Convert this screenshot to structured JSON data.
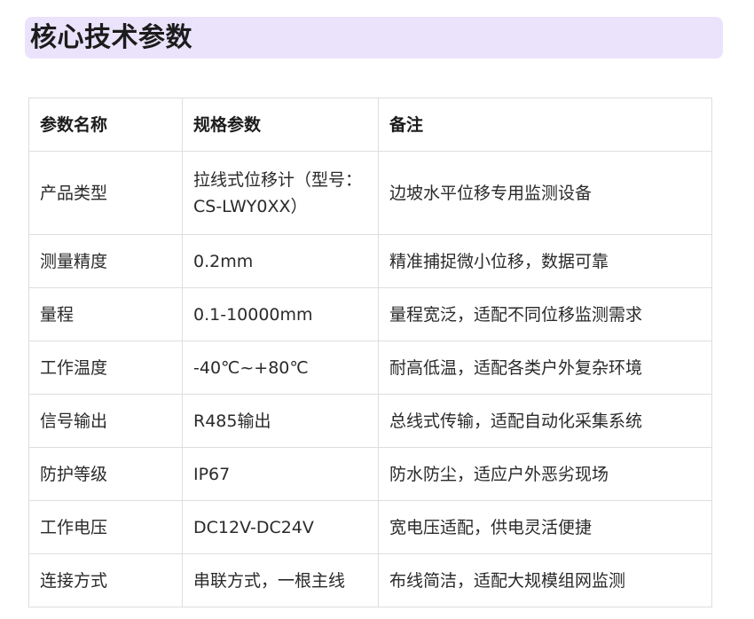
{
  "heading": "核心技术参数",
  "table": {
    "headers": [
      "参数名称",
      "规格参数",
      "备注"
    ],
    "rows": [
      [
        "产品类型",
        "拉线式位移计（型号：CS-LWY0XX）",
        "边坡水平位移专用监测设备"
      ],
      [
        "测量精度",
        "0.2mm",
        "精准捕捉微小位移，数据可靠"
      ],
      [
        "量程",
        "0.1-10000mm",
        "量程宽泛，适配不同位移监测需求"
      ],
      [
        "工作温度",
        "-40℃~+80℃",
        "耐高低温，适配各类户外复杂环境"
      ],
      [
        "信号输出",
        "R485输出",
        "总线式传输，适配自动化采集系统"
      ],
      [
        "防护等级",
        "IP67",
        "防水防尘，适应户外恶劣现场"
      ],
      [
        "工作电压",
        "DC12V-DC24V",
        "宽电压适配，供电灵活便捷"
      ],
      [
        "连接方式",
        "串联方式，一根主线",
        "布线简洁，适配大规模组网监测"
      ]
    ]
  }
}
